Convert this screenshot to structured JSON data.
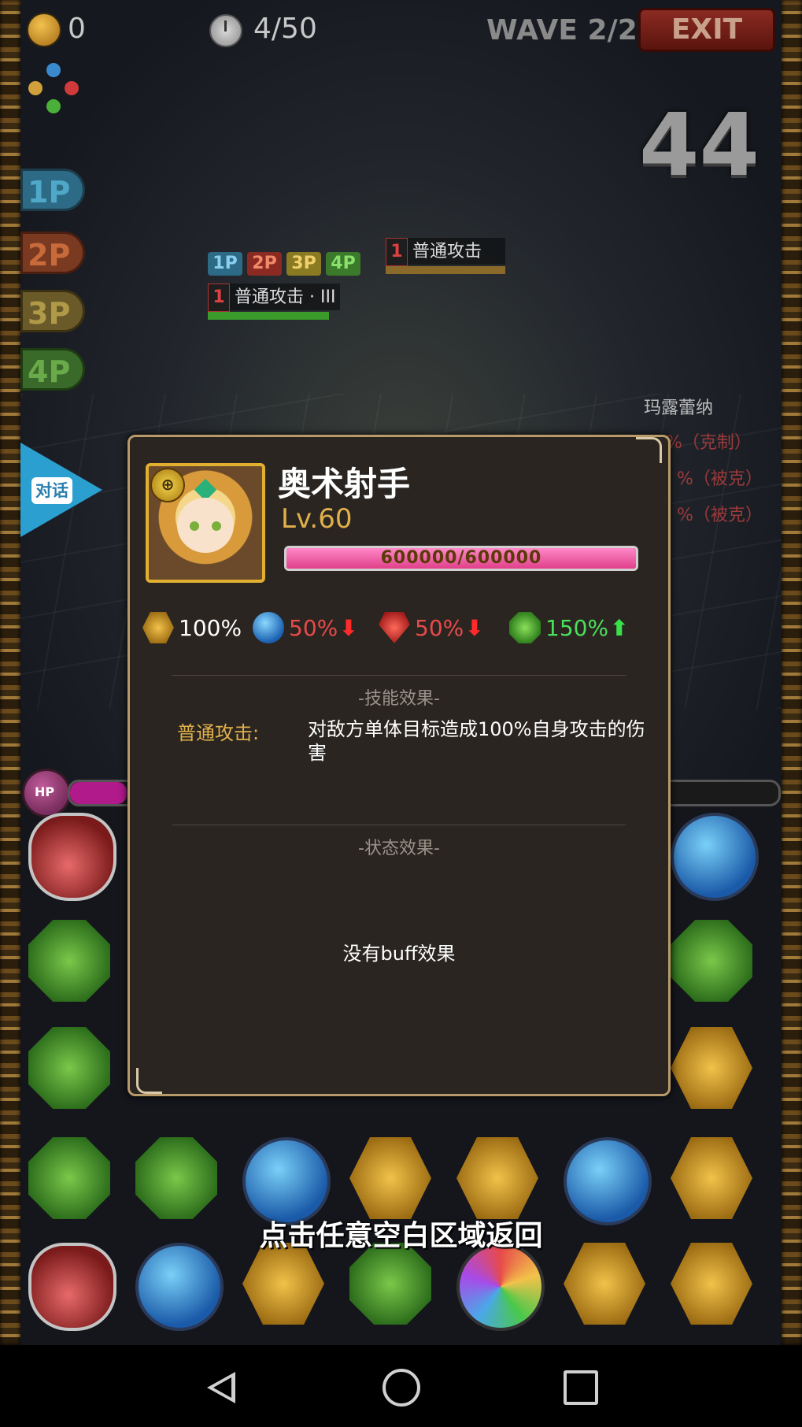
{
  "hud": {
    "coins": "0",
    "turns": "4/50",
    "wave": "WAVE 2/2",
    "exit_label": "EXIT",
    "turn_counter": "44"
  },
  "players": [
    "1P",
    "2P",
    "3P",
    "4P"
  ],
  "mini_tags": [
    "1P",
    "2P",
    "3P",
    "4P"
  ],
  "skill_bars": [
    {
      "num": "1",
      "label": "普通攻击"
    },
    {
      "num": "1",
      "label": "普通攻击 · III"
    }
  ],
  "enemy": {
    "name": "玛露蕾纳",
    "effects": [
      "%（克制）",
      "%（被克）",
      "%（被克）"
    ]
  },
  "talk_button": "对话",
  "hp_label": "HP",
  "board": [
    [
      "heal",
      "",
      "",
      "",
      "",
      "",
      "water"
    ],
    [
      "wind",
      "",
      "",
      "",
      "",
      "",
      "wind"
    ],
    [
      "wind",
      "",
      "",
      "",
      "",
      "",
      "earth"
    ],
    [
      "wind",
      "wind",
      "water",
      "earth",
      "earth",
      "water",
      "earth"
    ],
    [
      "heal",
      "water",
      "earth",
      "wind",
      "rainbow",
      "earth",
      "earth"
    ]
  ],
  "back_hint": "点击任意空白区域返回",
  "dialog": {
    "name": "奥术射手",
    "level": "Lv.60",
    "hp_text": "600000/600000",
    "hp_ratio": 1.0,
    "attrs": [
      {
        "type": "earth",
        "value": "100%",
        "trend": "",
        "color": "#ffffff"
      },
      {
        "type": "water",
        "value": "50%",
        "trend": "down",
        "color": "#e84a4a"
      },
      {
        "type": "fire",
        "value": "50%",
        "trend": "down",
        "color": "#e84a4a"
      },
      {
        "type": "wind",
        "value": "150%",
        "trend": "up",
        "color": "#4ae05a"
      }
    ],
    "skill_section": "-技能效果-",
    "skill_name": "普通攻击:",
    "skill_desc": "对敌方单体目标造成100%自身攻击的伤害",
    "status_section": "-状态效果-",
    "no_buff": "没有buff效果"
  },
  "colors": {
    "accent_gold": "#e0b04a",
    "dialog_bg": "#2a2521",
    "hp_pink": "#e0408a"
  }
}
